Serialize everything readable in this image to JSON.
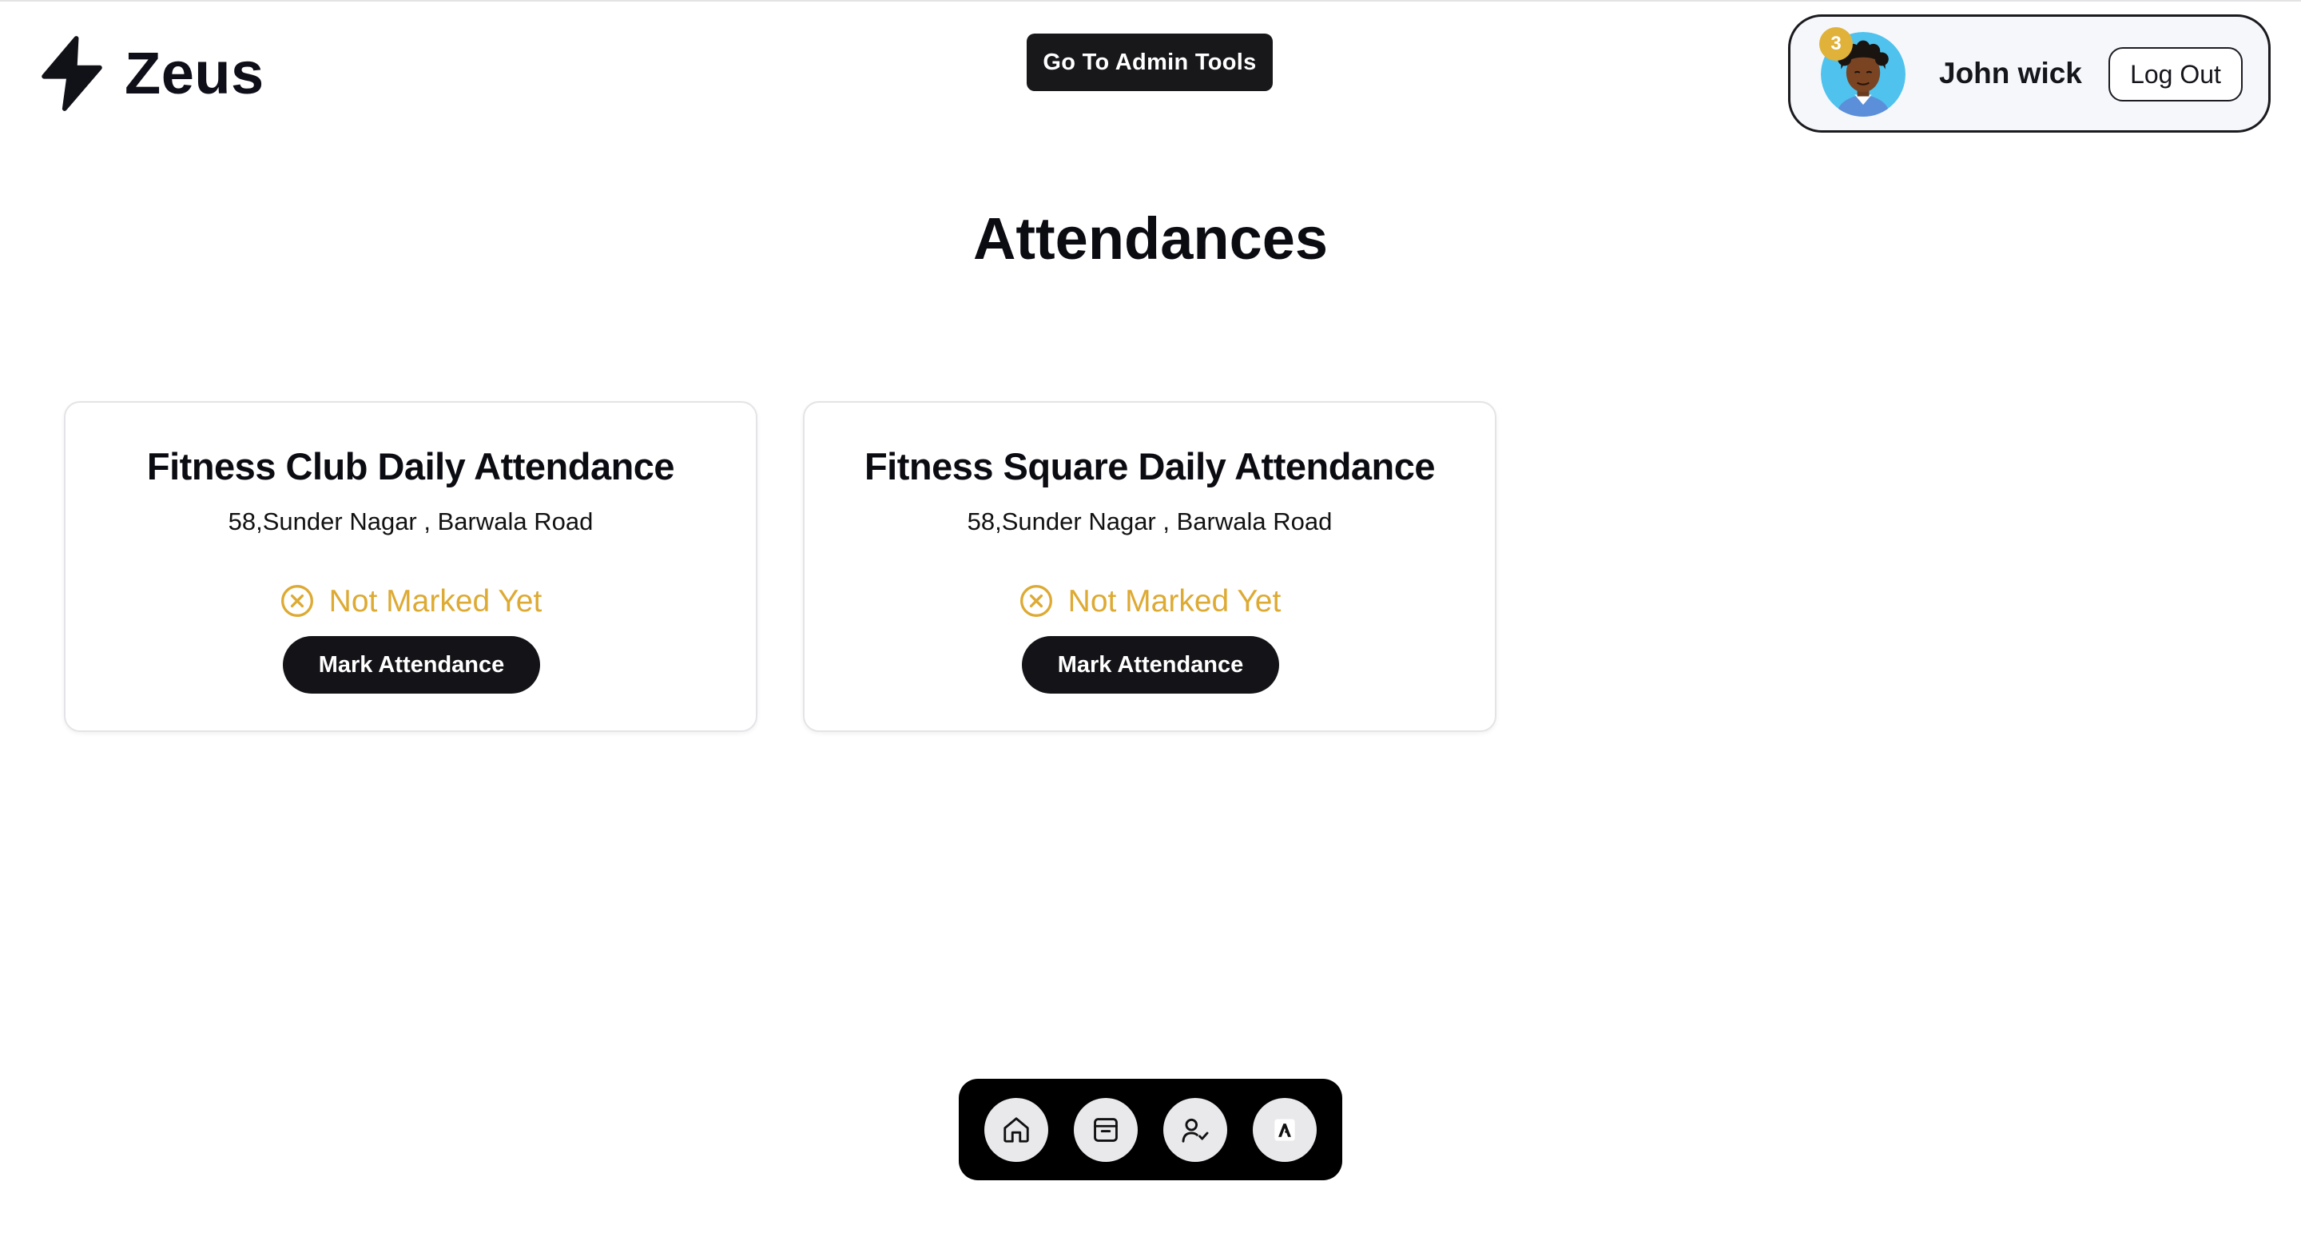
{
  "brand": {
    "name": "Zeus",
    "icon": "lightning-bolt-icon"
  },
  "header": {
    "admin_button": "Go To Admin Tools"
  },
  "user": {
    "name": "John wick",
    "notification_count": "3",
    "logout_label": "Log Out",
    "avatar": "user-avatar"
  },
  "page": {
    "title": "Attendances"
  },
  "cards": [
    {
      "title": "Fitness Club Daily Attendance",
      "address": "58,Sunder Nagar , Barwala Road",
      "status": "Not Marked Yet",
      "button": "Mark Attendance"
    },
    {
      "title": "Fitness Square Daily Attendance",
      "address": "58,Sunder Nagar , Barwala Road",
      "status": "Not Marked Yet",
      "button": "Mark Attendance"
    }
  ],
  "dock": {
    "items": [
      "home-icon",
      "inbox-icon",
      "user-check-icon",
      "app-logo-icon"
    ]
  },
  "colors": {
    "status_pending": "#ddaa33",
    "badge": "#e0b23a",
    "primary_button": "#141418"
  }
}
